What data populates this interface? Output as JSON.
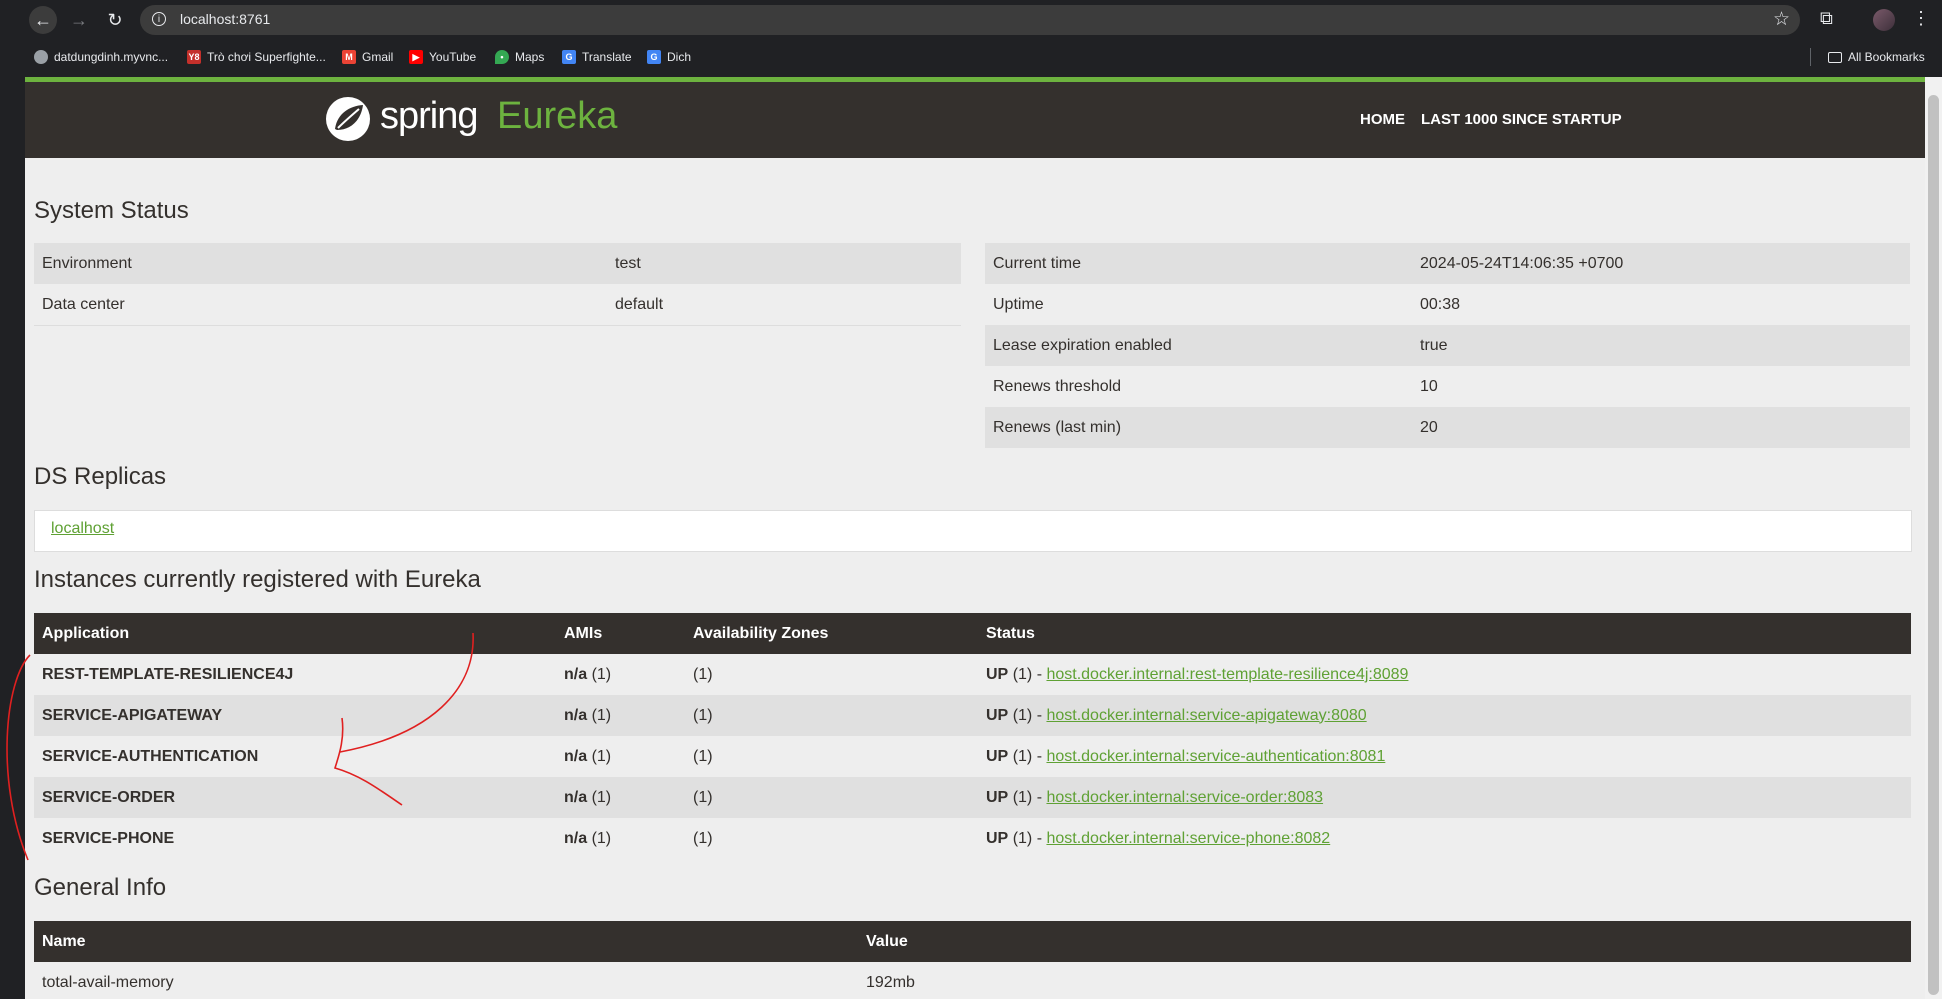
{
  "browser": {
    "url": "localhost:8761",
    "bookmarks": [
      {
        "label": "datdungdinh.myvnc...",
        "icon": "globe-icon",
        "color": "#9aa0a6"
      },
      {
        "label": "Trò chơi Superfighte...",
        "icon": "y8-icon",
        "color": "#c4302b"
      },
      {
        "label": "Gmail",
        "icon": "gmail-icon",
        "color": "#ea4335"
      },
      {
        "label": "YouTube",
        "icon": "youtube-icon",
        "color": "#ff0000"
      },
      {
        "label": "Maps",
        "icon": "maps-icon",
        "color": "#34a853"
      },
      {
        "label": "Translate",
        "icon": "translate-icon",
        "color": "#4285f4"
      },
      {
        "label": "Dich",
        "icon": "translate-icon",
        "color": "#4285f4"
      }
    ],
    "all_bookmarks": "All Bookmarks"
  },
  "header": {
    "logo_spring": "spring",
    "logo_eureka": "Eureka",
    "nav": {
      "home": "HOME",
      "last": "LAST 1000 SINCE STARTUP"
    }
  },
  "system_status": {
    "title": "System Status",
    "left": [
      {
        "label": "Environment",
        "value": "test"
      },
      {
        "label": "Data center",
        "value": "default"
      }
    ],
    "right": [
      {
        "label": "Current time",
        "value": "2024-05-24T14:06:35 +0700"
      },
      {
        "label": "Uptime",
        "value": "00:38"
      },
      {
        "label": "Lease expiration enabled",
        "value": "true"
      },
      {
        "label": "Renews threshold",
        "value": "10"
      },
      {
        "label": "Renews (last min)",
        "value": "20"
      }
    ]
  },
  "ds_replicas": {
    "title": "DS Replicas",
    "link": "localhost"
  },
  "instances": {
    "title": "Instances currently registered with Eureka",
    "headers": [
      "Application",
      "AMIs",
      "Availability Zones",
      "Status"
    ],
    "rows": [
      {
        "app": "REST-TEMPLATE-RESILIENCE4J",
        "ami": "n/a",
        "ami_count": "(1)",
        "zones": "(1)",
        "status": "UP",
        "status_count": "(1) -",
        "link": "host.docker.internal:rest-template-resilience4j:8089"
      },
      {
        "app": "SERVICE-APIGATEWAY",
        "ami": "n/a",
        "ami_count": "(1)",
        "zones": "(1)",
        "status": "UP",
        "status_count": "(1) -",
        "link": "host.docker.internal:service-apigateway:8080"
      },
      {
        "app": "SERVICE-AUTHENTICATION",
        "ami": "n/a",
        "ami_count": "(1)",
        "zones": "(1)",
        "status": "UP",
        "status_count": "(1) -",
        "link": "host.docker.internal:service-authentication:8081"
      },
      {
        "app": "SERVICE-ORDER",
        "ami": "n/a",
        "ami_count": "(1)",
        "zones": "(1)",
        "status": "UP",
        "status_count": "(1) -",
        "link": "host.docker.internal:service-order:8083"
      },
      {
        "app": "SERVICE-PHONE",
        "ami": "n/a",
        "ami_count": "(1)",
        "zones": "(1)",
        "status": "UP",
        "status_count": "(1) -",
        "link": "host.docker.internal:service-phone:8082"
      }
    ]
  },
  "general_info": {
    "title": "General Info",
    "headers": [
      "Name",
      "Value"
    ],
    "rows": [
      {
        "name": "total-avail-memory",
        "value": "192mb"
      }
    ]
  },
  "colors": {
    "accent": "#6db33f",
    "header_bg": "#34302d",
    "annotation": "#e02020"
  }
}
